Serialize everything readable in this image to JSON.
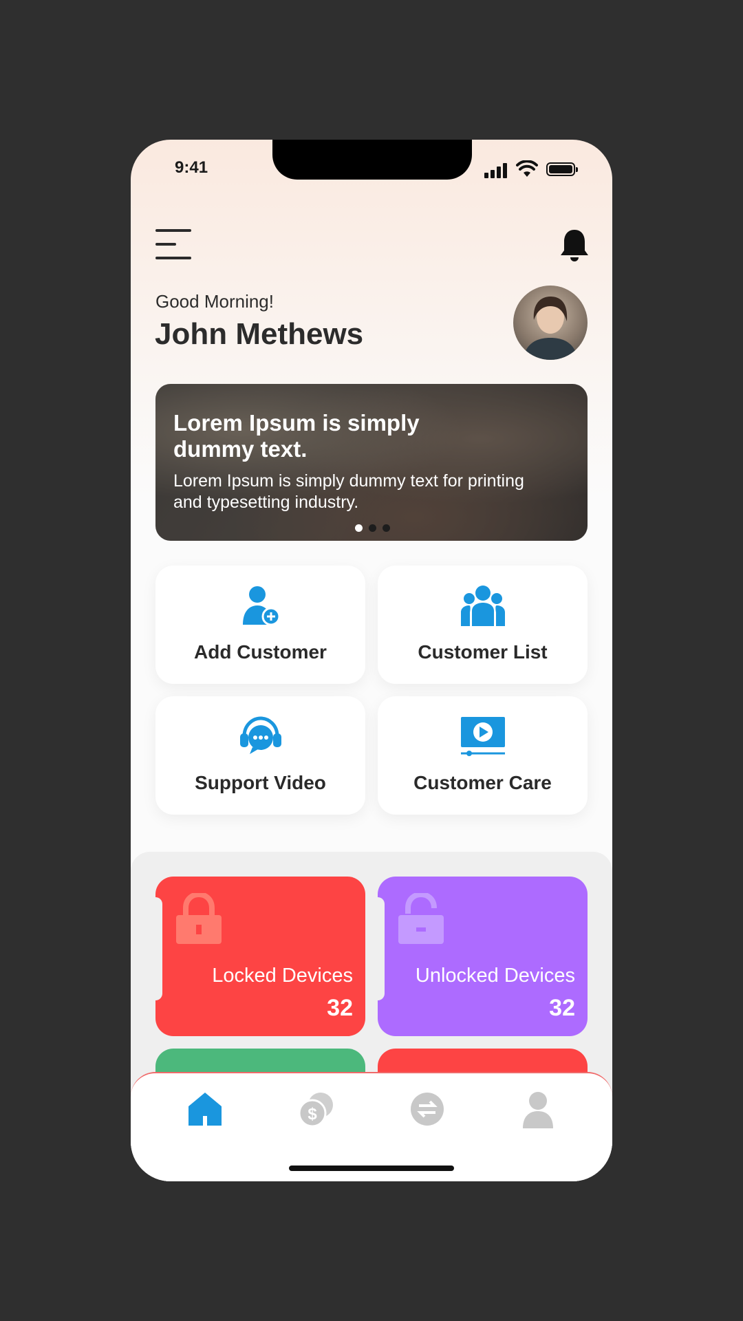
{
  "status_bar": {
    "time": "9:41"
  },
  "header": {
    "greeting": "Good Morning!",
    "user_name": "John Methews"
  },
  "banner": {
    "title": "Lorem Ipsum is simply dummy text.",
    "text": "Lorem Ipsum is simply dummy text for printing and typesetting industry.",
    "slide_count": 3,
    "active_slide": 1
  },
  "quick_actions": [
    {
      "label": "Add Customer",
      "icon": "add-user-icon"
    },
    {
      "label": "Customer List",
      "icon": "group-icon"
    },
    {
      "label": "Support Video",
      "icon": "headset-chat-icon"
    },
    {
      "label": "Customer Care",
      "icon": "video-play-icon"
    }
  ],
  "stats": [
    {
      "label": "Locked Devices",
      "count": "32",
      "color": "#fd4444",
      "icon": "lock-icon"
    },
    {
      "label": "Unlocked Devices",
      "count": "32",
      "color": "#ad6bff",
      "icon": "unlock-icon"
    },
    {
      "color": "#4cb87c"
    },
    {
      "color": "#fd4444"
    }
  ],
  "bottom_nav": [
    {
      "icon": "home-icon",
      "active": true
    },
    {
      "icon": "coins-icon",
      "active": false
    },
    {
      "icon": "transfer-icon",
      "active": false
    },
    {
      "icon": "profile-icon",
      "active": false
    }
  ],
  "colors": {
    "accent": "#1a96de",
    "inactive": "#c8c8c8"
  }
}
